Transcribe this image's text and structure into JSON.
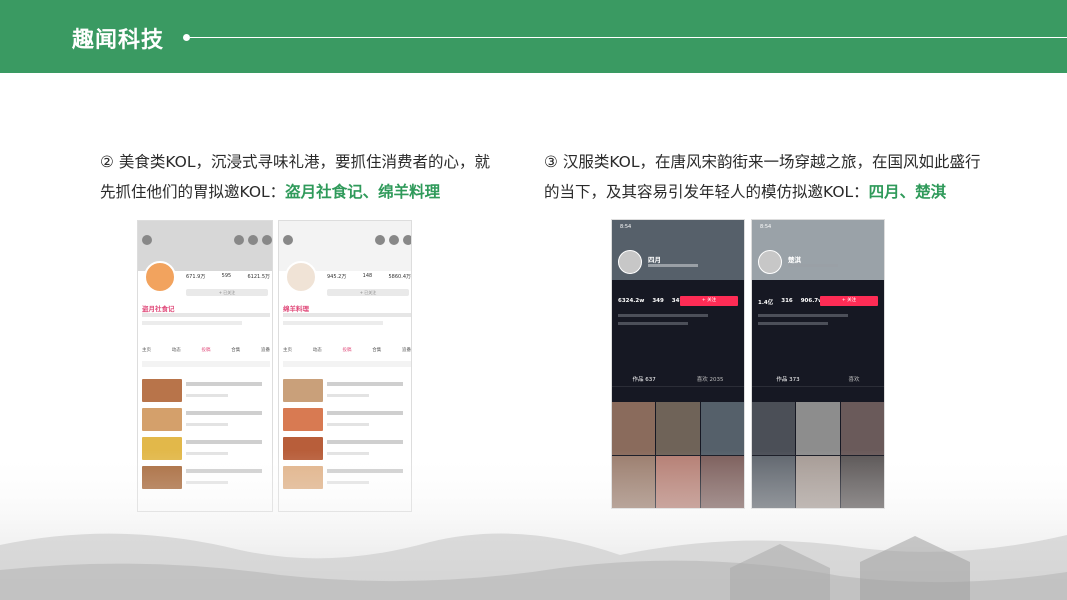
{
  "header": {
    "brand": "趣闻科技",
    "color": "#3a9a62"
  },
  "left": {
    "text": "② 美食类KOL，沉浸式寻味礼港，要抓住消费者的心，就先抓住他们的胃拟邀KOL：",
    "highlight": "盗月社食记、绵羊料理",
    "highlight_color": "#2f9a5a",
    "phones": [
      {
        "name": "盗月社食记",
        "stats": [
          "671.9万",
          "595",
          "6121.5万"
        ],
        "follow_label": "+ 已关注",
        "tabs": [
          "主页",
          "动态",
          "投稿",
          "合集",
          "追番"
        ],
        "active_tab": "投稿"
      },
      {
        "name": "绵羊料理",
        "stats": [
          "945.2万",
          "148",
          "5860.4万"
        ],
        "follow_label": "+ 已关注",
        "tabs": [
          "主页",
          "动态",
          "投稿",
          "合集",
          "追番"
        ],
        "active_tab": "投稿"
      }
    ]
  },
  "right": {
    "text": "③ 汉服类KOL，在唐风宋韵街来一场穿越之旅，在国风如此盛行的当下，及其容易引发年轻人的模仿拟邀KOL：",
    "highlight": "四月、楚淇",
    "highlight_color": "#2f9a5a",
    "phones": [
      {
        "name": "四月",
        "time": "8:54",
        "nums": [
          "6324.2w",
          "349",
          "347.6w"
        ],
        "follow_label": "+ 关注",
        "tabs": [
          "作品 637",
          "喜欢 2035"
        ],
        "active_tab": "作品 637"
      },
      {
        "name": "楚淇",
        "time": "8:54",
        "nums": [
          "1.4亿",
          "316",
          "906.7w"
        ],
        "follow_label": "+ 关注",
        "tabs": [
          "作品 373",
          "喜欢"
        ],
        "active_tab": "作品 373"
      }
    ]
  }
}
